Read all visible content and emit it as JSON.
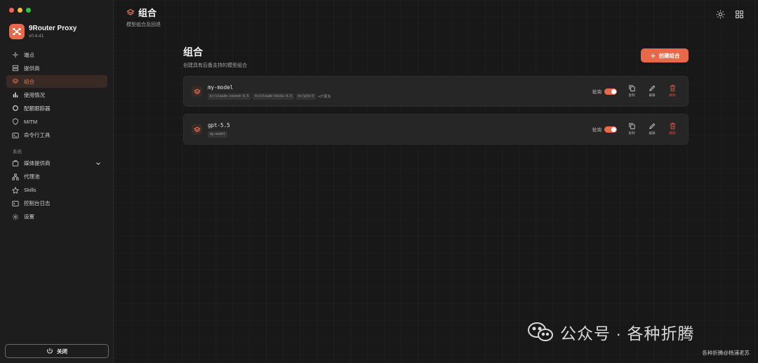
{
  "app": {
    "name": "9Router Proxy",
    "version": "v0.4.41"
  },
  "sidebar": {
    "items": [
      {
        "label": "端点",
        "icon": "endpoint-icon"
      },
      {
        "label": "提供商",
        "icon": "server-icon"
      },
      {
        "label": "组合",
        "icon": "layers-icon",
        "active": true
      },
      {
        "label": "使用情况",
        "icon": "bar-chart-icon"
      },
      {
        "label": "配额跟踪器",
        "icon": "donut-icon"
      },
      {
        "label": "MITM",
        "icon": "shield-icon"
      },
      {
        "label": "命令行工具",
        "icon": "terminal-icon"
      }
    ],
    "section_label": "系统",
    "system_items": [
      {
        "label": "媒体提供商",
        "icon": "media-icon"
      },
      {
        "label": "代理池",
        "icon": "network-icon"
      },
      {
        "label": "Skills",
        "icon": "skills-icon"
      },
      {
        "label": "控制台日志",
        "icon": "console-icon"
      },
      {
        "label": "设置",
        "icon": "gear-icon"
      }
    ],
    "close_label": "关闭"
  },
  "topbar": {
    "title": "组合",
    "subtitle": "模型组合及回退"
  },
  "page": {
    "title": "组合",
    "subtitle": "创建具有后备支持的模型组合",
    "create_label": "创建组合"
  },
  "combos": [
    {
      "name": "my-model",
      "tags": [
        "kr/claude-sonnet-4.5",
        "kr/claude-haiku-4.5",
        "kr/glm-5"
      ],
      "more": "+27更多",
      "toggle_label": "轮询",
      "enabled": true
    },
    {
      "name": "gpt-5.5",
      "tags": [
        "my-model"
      ],
      "more": "",
      "toggle_label": "轮询",
      "enabled": true
    }
  ],
  "actions": {
    "copy": "复制",
    "edit": "编辑",
    "delete": "删除"
  },
  "watermark": {
    "main": "公众号 · 各种折腾",
    "sub": "各种折腾@杨浦老苏"
  },
  "colors": {
    "accent": "#e8684a",
    "danger": "#e14a3e",
    "background": "#181818"
  }
}
